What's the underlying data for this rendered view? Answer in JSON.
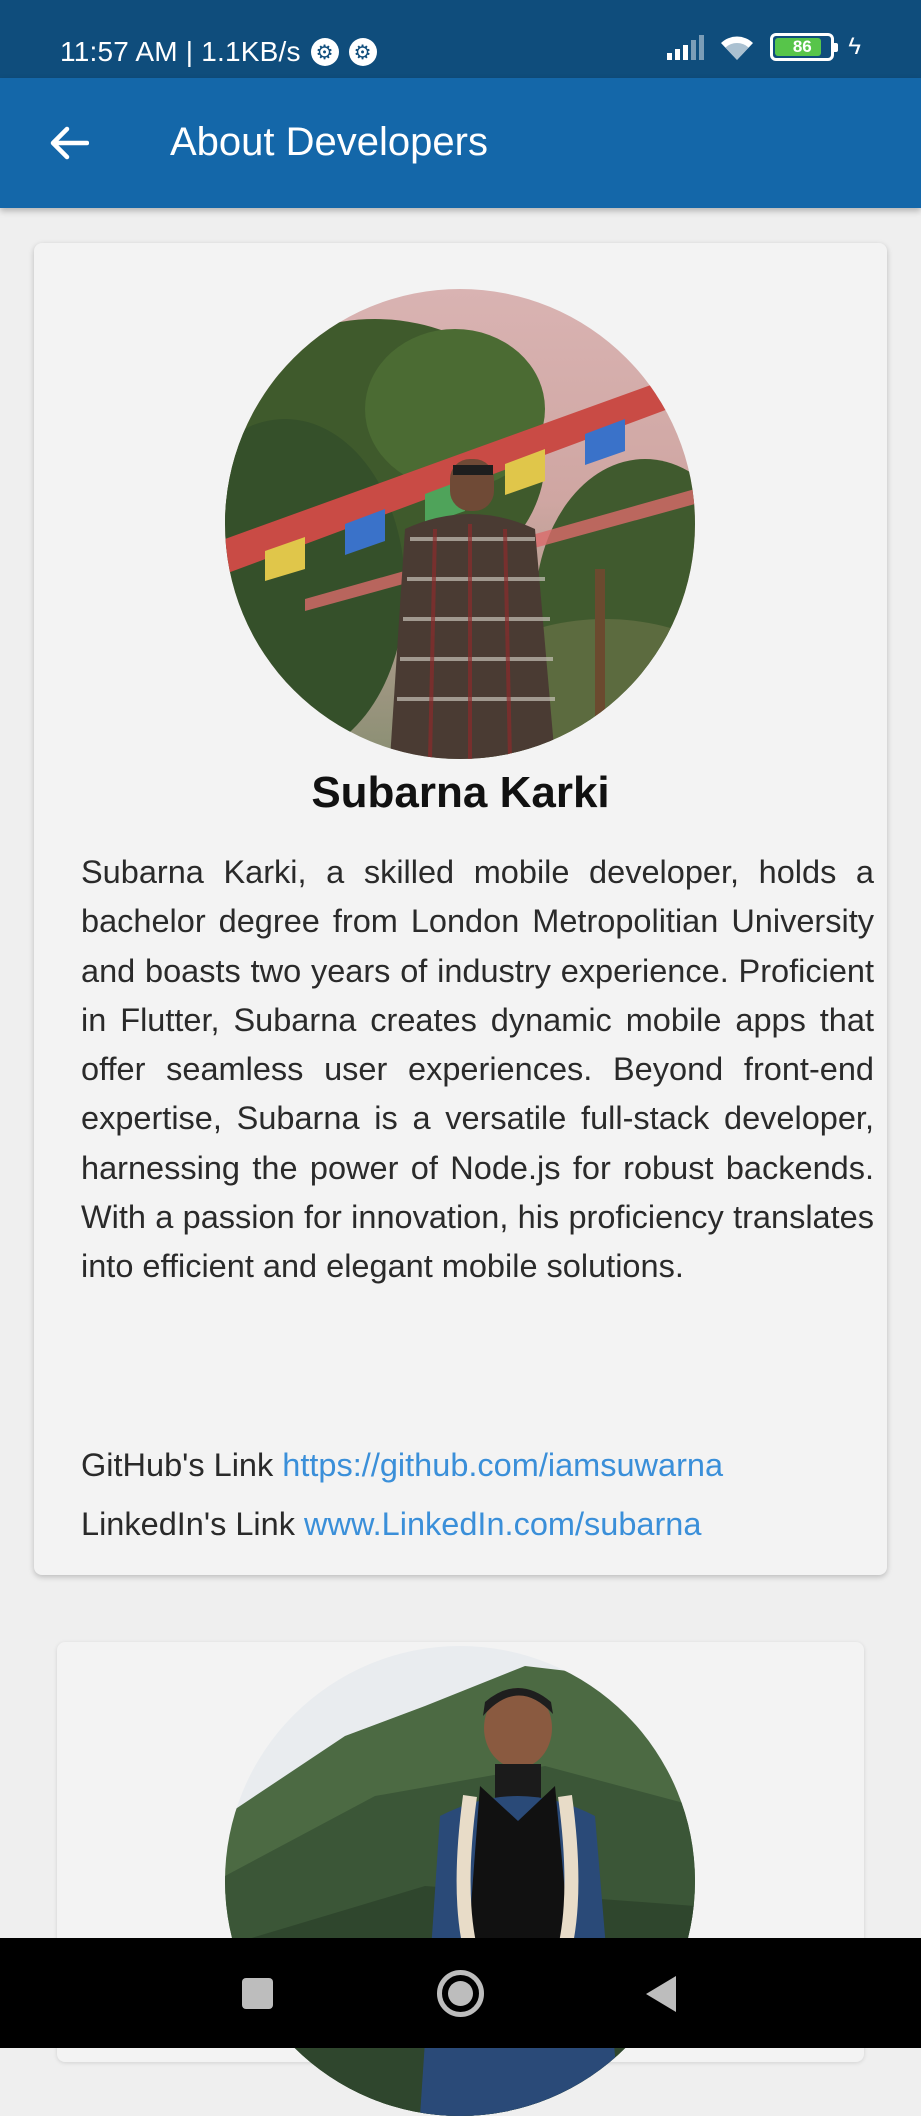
{
  "status_bar": {
    "time_speed": "11:57 AM | 1.1KB/s",
    "notification_icons": [
      "gear-icon",
      "gear-icon"
    ],
    "battery_level": "86",
    "battery_fraction": 0.86,
    "icons": [
      "signal-icon",
      "wifi-icon",
      "battery-icon",
      "charging-icon"
    ]
  },
  "app_bar": {
    "title": "About Developers",
    "back_icon": "arrow-left-icon",
    "background_color": "#1467a9",
    "status_color": "#0f4d7c"
  },
  "developers": [
    {
      "name": "Subarna Karki",
      "bio": "Subarna Karki, a skilled mobile developer, holds a bachelor degree from London Metropolitian University and boasts two years of industry experience. Proficient in Flutter, Subarna creates dynamic mobile apps that offer seamless user experiences. Beyond front-end expertise, Subarna is a versatile full-stack developer, harnessing the power of Node.js for robust backends. With a passion for innovation, his proficiency translates into efficient and elegant mobile solutions.",
      "github_label": "GitHub's Link",
      "github_url": "https://github.com/iamsuwarna",
      "linkedin_label": "LinkedIn's Link",
      "linkedin_url": "www.LinkedIn.com/subarna"
    }
  ],
  "link_color": "#3a8fd9",
  "nav_bar": {
    "icons": [
      "recent-apps-icon",
      "home-icon",
      "back-triangle-icon"
    ]
  }
}
